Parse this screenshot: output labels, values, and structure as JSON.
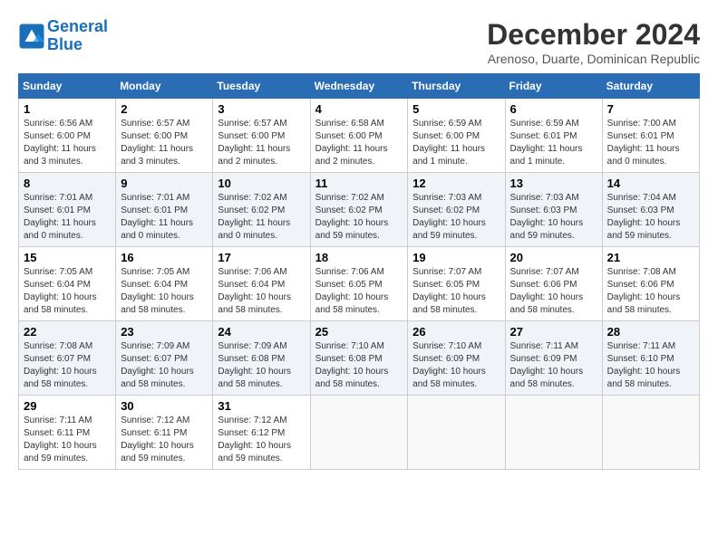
{
  "logo": {
    "line1": "General",
    "line2": "Blue"
  },
  "title": "December 2024",
  "location": "Arenoso, Duarte, Dominican Republic",
  "weekdays": [
    "Sunday",
    "Monday",
    "Tuesday",
    "Wednesday",
    "Thursday",
    "Friday",
    "Saturday"
  ],
  "weeks": [
    [
      {
        "day": "1",
        "info": "Sunrise: 6:56 AM\nSunset: 6:00 PM\nDaylight: 11 hours\nand 3 minutes."
      },
      {
        "day": "2",
        "info": "Sunrise: 6:57 AM\nSunset: 6:00 PM\nDaylight: 11 hours\nand 3 minutes."
      },
      {
        "day": "3",
        "info": "Sunrise: 6:57 AM\nSunset: 6:00 PM\nDaylight: 11 hours\nand 2 minutes."
      },
      {
        "day": "4",
        "info": "Sunrise: 6:58 AM\nSunset: 6:00 PM\nDaylight: 11 hours\nand 2 minutes."
      },
      {
        "day": "5",
        "info": "Sunrise: 6:59 AM\nSunset: 6:00 PM\nDaylight: 11 hours\nand 1 minute."
      },
      {
        "day": "6",
        "info": "Sunrise: 6:59 AM\nSunset: 6:01 PM\nDaylight: 11 hours\nand 1 minute."
      },
      {
        "day": "7",
        "info": "Sunrise: 7:00 AM\nSunset: 6:01 PM\nDaylight: 11 hours\nand 0 minutes."
      }
    ],
    [
      {
        "day": "8",
        "info": "Sunrise: 7:01 AM\nSunset: 6:01 PM\nDaylight: 11 hours\nand 0 minutes."
      },
      {
        "day": "9",
        "info": "Sunrise: 7:01 AM\nSunset: 6:01 PM\nDaylight: 11 hours\nand 0 minutes."
      },
      {
        "day": "10",
        "info": "Sunrise: 7:02 AM\nSunset: 6:02 PM\nDaylight: 11 hours\nand 0 minutes."
      },
      {
        "day": "11",
        "info": "Sunrise: 7:02 AM\nSunset: 6:02 PM\nDaylight: 10 hours\nand 59 minutes."
      },
      {
        "day": "12",
        "info": "Sunrise: 7:03 AM\nSunset: 6:02 PM\nDaylight: 10 hours\nand 59 minutes."
      },
      {
        "day": "13",
        "info": "Sunrise: 7:03 AM\nSunset: 6:03 PM\nDaylight: 10 hours\nand 59 minutes."
      },
      {
        "day": "14",
        "info": "Sunrise: 7:04 AM\nSunset: 6:03 PM\nDaylight: 10 hours\nand 59 minutes."
      }
    ],
    [
      {
        "day": "15",
        "info": "Sunrise: 7:05 AM\nSunset: 6:04 PM\nDaylight: 10 hours\nand 58 minutes."
      },
      {
        "day": "16",
        "info": "Sunrise: 7:05 AM\nSunset: 6:04 PM\nDaylight: 10 hours\nand 58 minutes."
      },
      {
        "day": "17",
        "info": "Sunrise: 7:06 AM\nSunset: 6:04 PM\nDaylight: 10 hours\nand 58 minutes."
      },
      {
        "day": "18",
        "info": "Sunrise: 7:06 AM\nSunset: 6:05 PM\nDaylight: 10 hours\nand 58 minutes."
      },
      {
        "day": "19",
        "info": "Sunrise: 7:07 AM\nSunset: 6:05 PM\nDaylight: 10 hours\nand 58 minutes."
      },
      {
        "day": "20",
        "info": "Sunrise: 7:07 AM\nSunset: 6:06 PM\nDaylight: 10 hours\nand 58 minutes."
      },
      {
        "day": "21",
        "info": "Sunrise: 7:08 AM\nSunset: 6:06 PM\nDaylight: 10 hours\nand 58 minutes."
      }
    ],
    [
      {
        "day": "22",
        "info": "Sunrise: 7:08 AM\nSunset: 6:07 PM\nDaylight: 10 hours\nand 58 minutes."
      },
      {
        "day": "23",
        "info": "Sunrise: 7:09 AM\nSunset: 6:07 PM\nDaylight: 10 hours\nand 58 minutes."
      },
      {
        "day": "24",
        "info": "Sunrise: 7:09 AM\nSunset: 6:08 PM\nDaylight: 10 hours\nand 58 minutes."
      },
      {
        "day": "25",
        "info": "Sunrise: 7:10 AM\nSunset: 6:08 PM\nDaylight: 10 hours\nand 58 minutes."
      },
      {
        "day": "26",
        "info": "Sunrise: 7:10 AM\nSunset: 6:09 PM\nDaylight: 10 hours\nand 58 minutes."
      },
      {
        "day": "27",
        "info": "Sunrise: 7:11 AM\nSunset: 6:09 PM\nDaylight: 10 hours\nand 58 minutes."
      },
      {
        "day": "28",
        "info": "Sunrise: 7:11 AM\nSunset: 6:10 PM\nDaylight: 10 hours\nand 58 minutes."
      }
    ],
    [
      {
        "day": "29",
        "info": "Sunrise: 7:11 AM\nSunset: 6:11 PM\nDaylight: 10 hours\nand 59 minutes."
      },
      {
        "day": "30",
        "info": "Sunrise: 7:12 AM\nSunset: 6:11 PM\nDaylight: 10 hours\nand 59 minutes."
      },
      {
        "day": "31",
        "info": "Sunrise: 7:12 AM\nSunset: 6:12 PM\nDaylight: 10 hours\nand 59 minutes."
      },
      null,
      null,
      null,
      null
    ]
  ]
}
